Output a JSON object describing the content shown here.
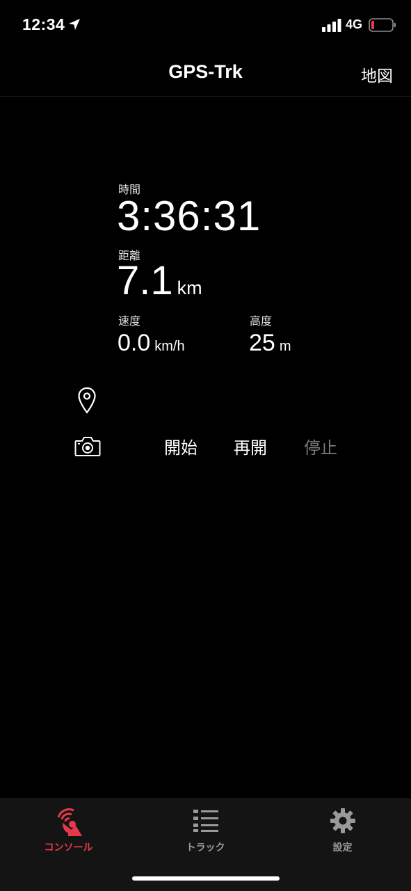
{
  "status_bar": {
    "time": "12:34",
    "network": "4G",
    "battery_level": 0.1,
    "battery_color": "#e8394a"
  },
  "nav": {
    "title": "GPS-Trk",
    "right_label": "地図"
  },
  "stats": {
    "time_label": "時間",
    "time_value": "3:36:31",
    "distance_label": "距離",
    "distance_value": "7.1",
    "distance_unit": "km",
    "speed_label": "速度",
    "speed_value": "0.0",
    "speed_unit": "km/h",
    "altitude_label": "高度",
    "altitude_value": "25",
    "altitude_unit": "m"
  },
  "controls": {
    "start_label": "開始",
    "resume_label": "再開",
    "stop_label": "停止",
    "pin_icon": "map-pin-icon",
    "camera_icon": "camera-icon"
  },
  "tabs": [
    {
      "label": "コンソール",
      "icon": "satellite-dish-icon",
      "active": true
    },
    {
      "label": "トラック",
      "icon": "list-icon",
      "active": false
    },
    {
      "label": "設定",
      "icon": "gear-icon",
      "active": false
    }
  ],
  "colors": {
    "accent": "#e8394a",
    "inactive": "#9a9a9a",
    "disabled": "#7a7a7a"
  }
}
